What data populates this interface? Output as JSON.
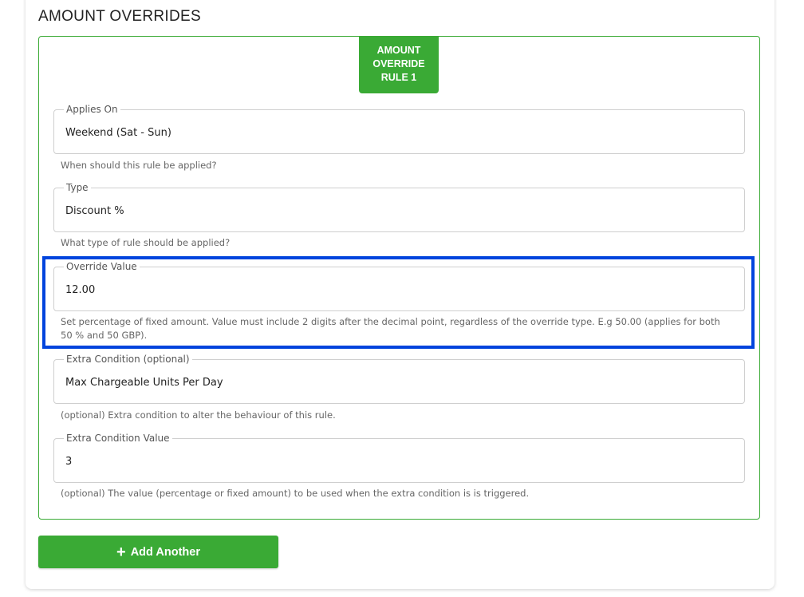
{
  "section": {
    "title": "AMOUNT OVERRIDES"
  },
  "rule": {
    "badge_line1": "AMOUNT",
    "badge_line2": "OVERRIDE",
    "badge_line3": "RULE 1",
    "fields": [
      {
        "label": "Applies On",
        "value": "Weekend (Sat - Sun)",
        "helper": "When should this rule be applied?"
      },
      {
        "label": "Type",
        "value": "Discount %",
        "helper": "What type of rule should be applied?"
      },
      {
        "label": "Override Value",
        "value": "12.00",
        "helper": "Set percentage of fixed amount. Value must include 2 digits after the decimal point, regardless of the override type. E.g 50.00 (applies for both 50 % and 50 GBP)."
      },
      {
        "label": "Extra Condition (optional)",
        "value": "Max Chargeable Units Per Day",
        "helper": "(optional) Extra condition to alter the behaviour of this rule."
      },
      {
        "label": "Extra Condition Value",
        "value": "3",
        "helper": "(optional) The value (percentage or fixed amount) to be used when the extra condition is is triggered."
      }
    ]
  },
  "actions": {
    "add_label": "Add Another",
    "add_icon": "plus-icon"
  },
  "colors": {
    "accent": "#3aaa35",
    "highlight": "#0044dd"
  }
}
